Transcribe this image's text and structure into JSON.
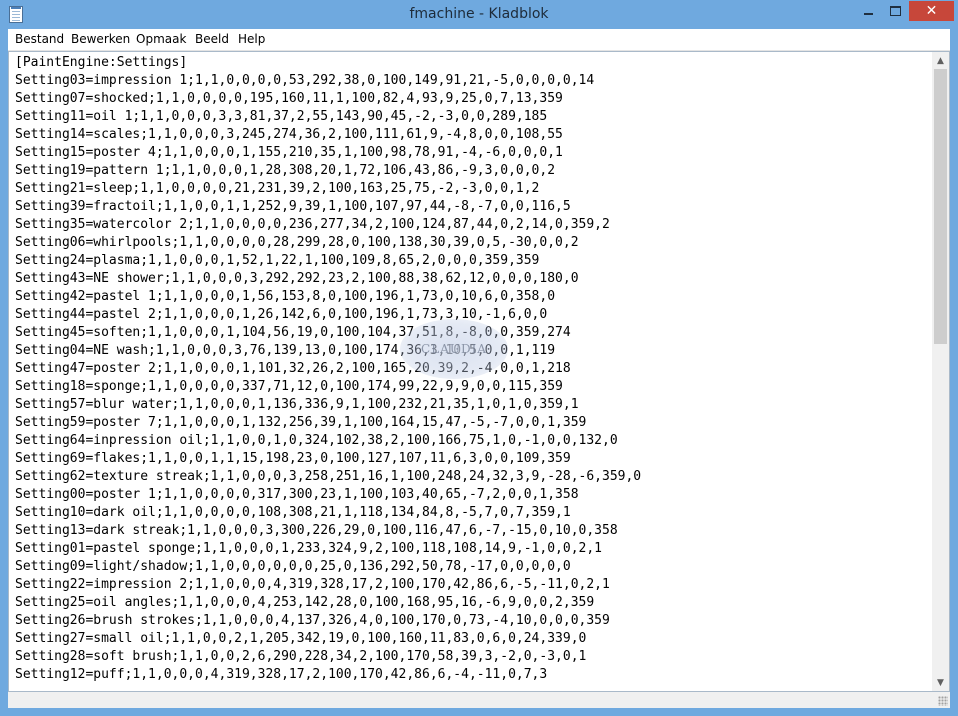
{
  "window": {
    "title": "fmachine - Kladblok",
    "icon": "notepad-icon",
    "controls": {
      "minimize": "minimize-icon",
      "maximize": "maximize-icon",
      "close": "✕"
    }
  },
  "menu": {
    "items": [
      "Bestand",
      "Bewerken",
      "Opmaak",
      "Beeld",
      "Help"
    ]
  },
  "editor": {
    "lines": [
      "[PaintEngine:Settings]",
      "Setting03=impression 1;1,1,0,0,0,0,53,292,38,0,100,149,91,21,-5,0,0,0,0,14",
      "Setting07=shocked;1,1,0,0,0,0,195,160,11,1,100,82,4,93,9,25,0,7,13,359",
      "Setting11=oil 1;1,1,0,0,0,3,3,81,37,2,55,143,90,45,-2,-3,0,0,289,185",
      "Setting14=scales;1,1,0,0,0,3,245,274,36,2,100,111,61,9,-4,8,0,0,108,55",
      "Setting15=poster 4;1,1,0,0,0,1,155,210,35,1,100,98,78,91,-4,-6,0,0,0,1",
      "Setting19=pattern 1;1,1,0,0,0,1,28,308,20,1,72,106,43,86,-9,3,0,0,0,2",
      "Setting21=sleep;1,1,0,0,0,0,21,231,39,2,100,163,25,75,-2,-3,0,0,1,2",
      "Setting39=fractoil;1,1,0,0,1,1,252,9,39,1,100,107,97,44,-8,-7,0,0,116,5",
      "Setting35=watercolor 2;1,1,0,0,0,0,236,277,34,2,100,124,87,44,0,2,14,0,359,2",
      "Setting06=whirlpools;1,1,0,0,0,0,28,299,28,0,100,138,30,39,0,5,-30,0,0,2",
      "Setting24=plasma;1,1,0,0,0,1,52,1,22,1,100,109,8,65,2,0,0,0,359,359",
      "Setting43=NE shower;1,1,0,0,0,3,292,292,23,2,100,88,38,62,12,0,0,0,180,0",
      "Setting42=pastel 1;1,1,0,0,0,1,56,153,8,0,100,196,1,73,0,10,6,0,358,0",
      "Setting44=pastel 2;1,1,0,0,0,1,26,142,6,0,100,196,1,73,3,10,-1,6,0,0",
      "Setting45=soften;1,1,0,0,0,1,104,56,19,0,100,104,37,51,8,-8,0,0,359,274",
      "Setting04=NE wash;1,1,0,0,0,3,76,139,13,0,100,174,36,3,10,5,0,0,1,119",
      "Setting47=poster 2;1,1,0,0,0,1,101,32,26,2,100,165,20,39,2,-4,0,0,1,218",
      "Setting18=sponge;1,1,0,0,0,0,337,71,12,0,100,174,99,22,9,9,0,0,115,359",
      "Setting57=blur water;1,1,0,0,0,1,136,336,9,1,100,232,21,35,1,0,1,0,359,1",
      "Setting59=poster 7;1,1,0,0,0,1,132,256,39,1,100,164,15,47,-5,-7,0,0,1,359",
      "Setting64=inpression oil;1,1,0,0,1,0,324,102,38,2,100,166,75,1,0,-1,0,0,132,0",
      "Setting69=flakes;1,1,0,0,1,1,15,198,23,0,100,127,107,11,6,3,0,0,109,359",
      "Setting62=texture streak;1,1,0,0,0,3,258,251,16,1,100,248,24,32,3,9,-28,-6,359,0",
      "Setting00=poster 1;1,1,0,0,0,0,317,300,23,1,100,103,40,65,-7,2,0,0,1,358",
      "Setting10=dark oil;1,1,0,0,0,0,108,308,21,1,118,134,84,8,-5,7,0,7,359,1",
      "Setting13=dark streak;1,1,0,0,0,3,300,226,29,0,100,116,47,6,-7,-15,0,10,0,358",
      "Setting01=pastel sponge;1,1,0,0,0,1,233,324,9,2,100,118,108,14,9,-1,0,0,2,1",
      "Setting09=light/shadow;1,1,0,0,0,0,0,0,25,0,136,292,50,78,-17,0,0,0,0,0",
      "Setting22=impression 2;1,1,0,0,0,4,319,328,17,2,100,170,42,86,6,-5,-11,0,2,1",
      "Setting25=oil angles;1,1,0,0,0,4,253,142,28,0,100,168,95,16,-6,9,0,0,2,359",
      "Setting26=brush strokes;1,1,0,0,0,4,137,326,4,0,100,170,0,73,-4,10,0,0,0,359",
      "Setting27=small oil;1,1,0,0,2,1,205,342,19,0,100,160,11,83,0,6,0,24,339,0",
      "Setting28=soft brush;1,1,0,0,2,6,290,228,34,2,100,170,58,39,3,-2,0,-3,0,1",
      "Setting12=puff;1,1,0,0,0,4,319,328,17,2,100,170,42,86,6,-4,-11,0,7,3"
    ]
  },
  "watermark": {
    "text": "CLAUDIA"
  },
  "scrollbar": {
    "up": "▲",
    "down": "▼"
  }
}
